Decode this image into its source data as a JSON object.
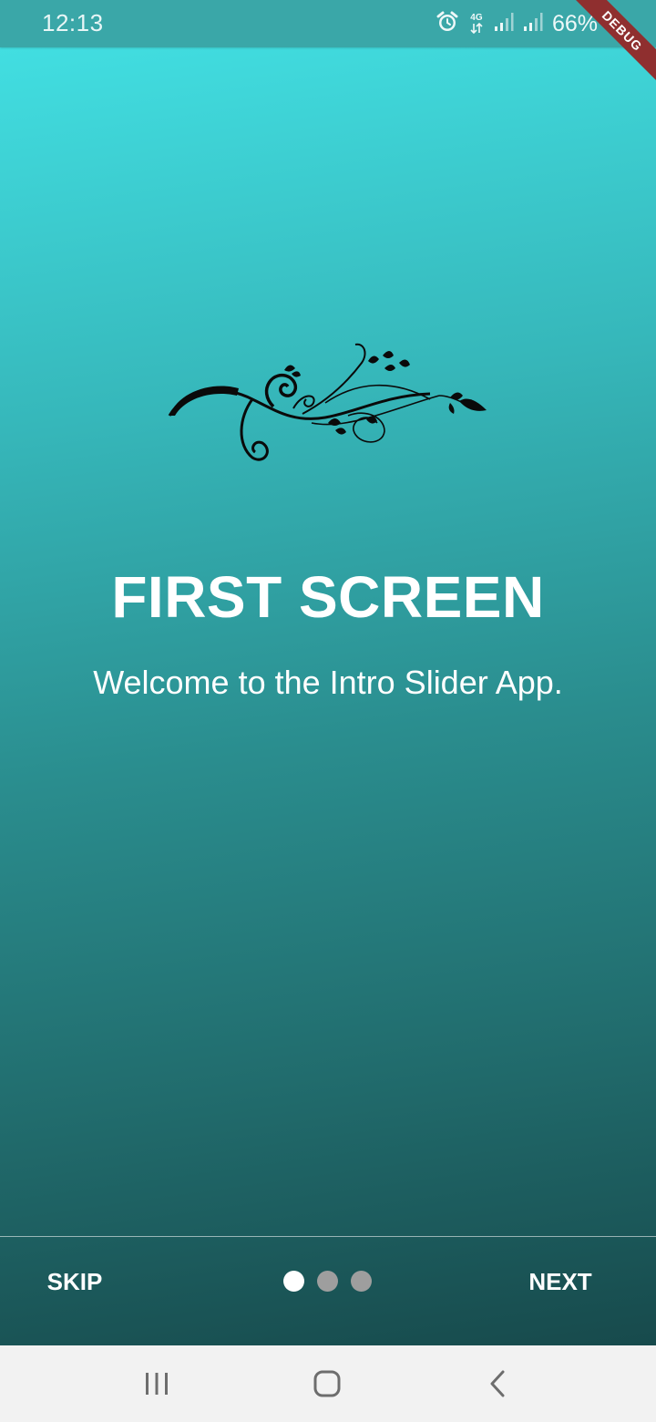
{
  "status_bar": {
    "time": "12:13",
    "network_type": "4G",
    "battery": "66%",
    "icons": [
      "alarm-icon",
      "data-arrows-icon",
      "signal-icon",
      "signal-icon-2"
    ]
  },
  "debug_banner": "DEBUG",
  "slide": {
    "illustration": "floral-swirl-ornament",
    "title": "FIRST SCREEN",
    "description": "Welcome to the Intro Slider App."
  },
  "controls": {
    "skip_label": "SKIP",
    "next_label": "NEXT",
    "page_count": 3,
    "current_page": 1
  },
  "navigation_bar": {
    "buttons": [
      "recent-apps-icon",
      "home-icon",
      "back-icon"
    ]
  },
  "colors": {
    "gradient_top": "#43e3e6",
    "gradient_bottom": "#174a4c",
    "status_bar": "#3aa7a8",
    "dot_active": "#ffffff",
    "dot_inactive": "#9e9e9e",
    "debug_banner": "#8f2f2f"
  }
}
